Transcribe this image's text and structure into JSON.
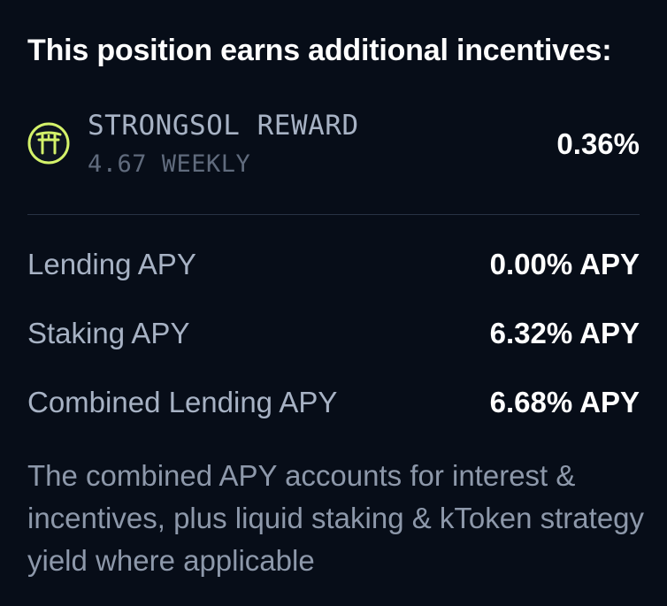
{
  "heading": "This position earns additional incentives:",
  "reward": {
    "icon": "torii-gate-icon",
    "name": "STRONGSOL REWARD",
    "sub": "4.67 WEEKLY",
    "value": "0.36%"
  },
  "stats": [
    {
      "label": "Lending APY",
      "value": "0.00% APY"
    },
    {
      "label": "Staking APY",
      "value": "6.32% APY"
    },
    {
      "label": "Combined Lending APY",
      "value": "6.68% APY"
    }
  ],
  "footnote": "The combined APY accounts for interest & incentives, plus liquid staking & kToken strategy yield where applicable",
  "colors": {
    "background": "#070d18",
    "icon_accent": "#d4f26a",
    "label": "#a7b2c4",
    "value": "#ffffff"
  }
}
